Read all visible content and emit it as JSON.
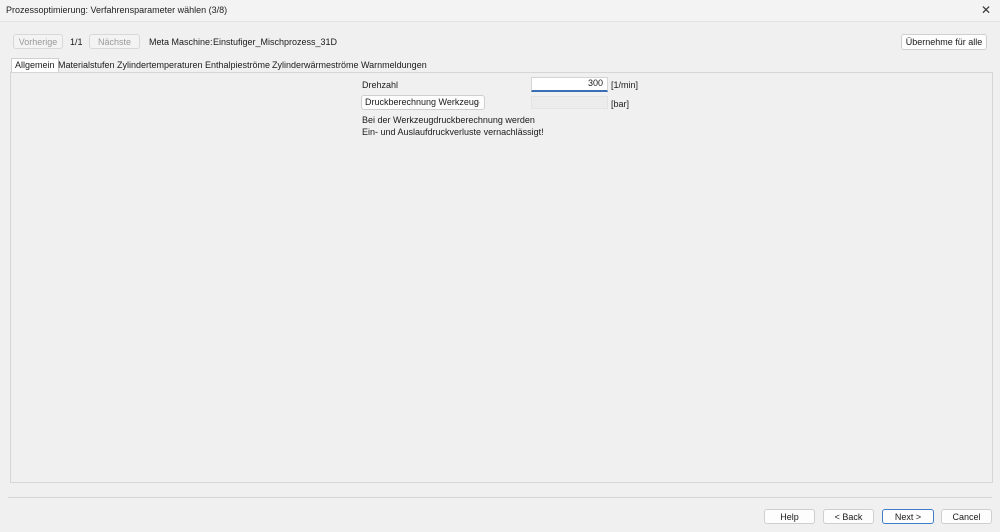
{
  "window": {
    "title": "Prozessoptimierung: Verfahrensparameter wählen (3/8)",
    "close_glyph": "✕"
  },
  "toolbar": {
    "prev_label": "Vorherige",
    "page_indicator": "1/1",
    "next_label": "Nächste",
    "meta_label": "Meta Maschine:",
    "meta_value": "Einstufiger_Mischprozess_31D",
    "apply_all_label": "Übernehme für alle"
  },
  "tabs": [
    {
      "label": "Allgemein",
      "active": true
    },
    {
      "label": "Materialstufen"
    },
    {
      "label": "Zylindertemperaturen"
    },
    {
      "label": "Enthalpieströme"
    },
    {
      "label": "Zylinderwärmeströme"
    },
    {
      "label": "Warnmeldungen"
    }
  ],
  "form": {
    "drehzahl_label": "Drehzahl",
    "drehzahl_value": "300",
    "drehzahl_unit": "[1/min]",
    "pressure_select_value": "Druckberechnung Werkzeug",
    "pressure_value": "",
    "pressure_unit": "[bar]",
    "note_line1": "Bei der Werkzeugdruckberechnung werden",
    "note_line2": "Ein- und Auslaufdruckverluste vernachlässigt!"
  },
  "footer": {
    "help_label": "Help",
    "back_label": "< Back",
    "next_label": "Next >",
    "cancel_label": "Cancel"
  }
}
